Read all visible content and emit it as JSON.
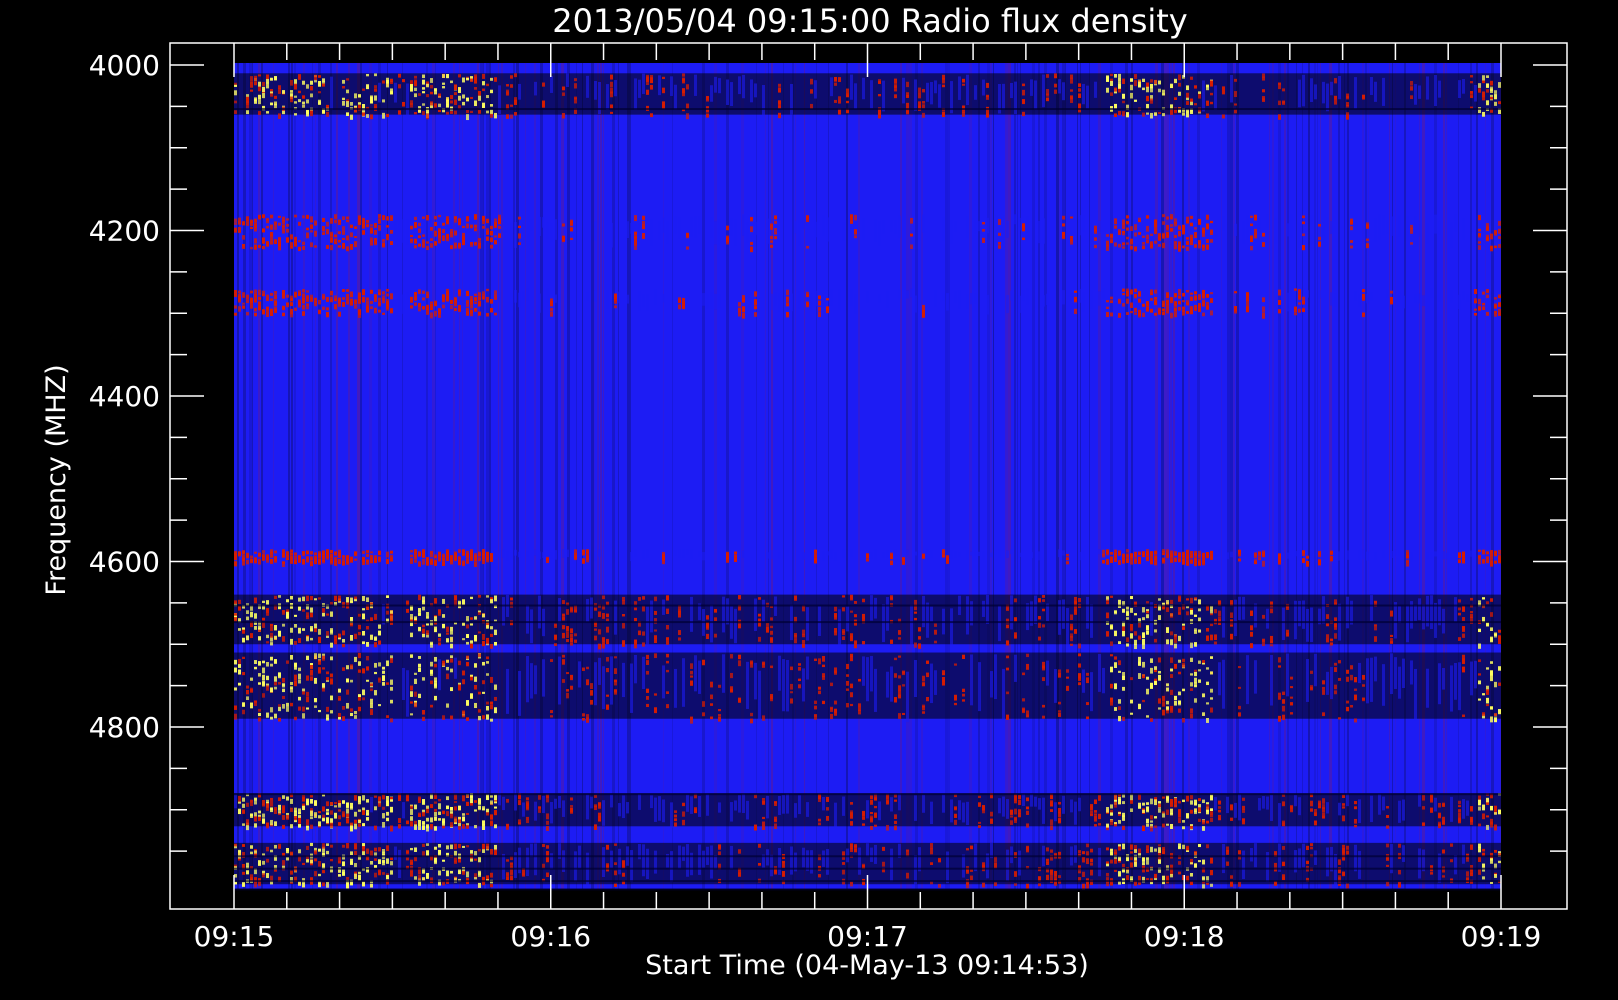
{
  "chart_data": {
    "type": "heatmap",
    "title": "2013/05/04 09:15:00 Radio flux density",
    "xlabel": "Start Time (04-May-13 09:14:53)",
    "ylabel": "Frequency (MHZ)",
    "x_tick_labels": [
      "09:15",
      "09:16",
      "09:17",
      "09:18",
      "09:19"
    ],
    "y_tick_labels": [
      "4000",
      "4200",
      "4400",
      "4600",
      "4800"
    ],
    "y_tick_values": [
      4000,
      4200,
      4400,
      4600,
      4800
    ],
    "y_minor_step": 50,
    "x_minor_per_major": 6,
    "ylim": [
      4000,
      5000
    ],
    "xlim": [
      "09:15",
      "09:19"
    ],
    "y_axis_inverted": true,
    "colormap": {
      "background_band": "#1d1cf4",
      "low": "#000000",
      "mid": "#d81c00",
      "high": "#ffff60"
    },
    "bright_bands_mhz": [
      {
        "from": 4010,
        "to": 4060,
        "intensity": "high"
      },
      {
        "from": 4180,
        "to": 4220,
        "intensity": "mid"
      },
      {
        "from": 4270,
        "to": 4300,
        "intensity": "mid"
      },
      {
        "from": 4585,
        "to": 4600,
        "intensity": "mid"
      },
      {
        "from": 4640,
        "to": 4700,
        "intensity": "high"
      },
      {
        "from": 4710,
        "to": 4790,
        "intensity": "high"
      },
      {
        "from": 4880,
        "to": 4920,
        "intensity": "high"
      },
      {
        "from": 4940,
        "to": 4990,
        "intensity": "high"
      }
    ],
    "active_time_ranges": [
      [
        "09:15:00",
        "09:15:30"
      ],
      [
        "09:15:33",
        "09:15:50"
      ],
      [
        "09:17:45",
        "09:18:05"
      ],
      [
        "09:18:55",
        "09:19:00"
      ]
    ]
  }
}
